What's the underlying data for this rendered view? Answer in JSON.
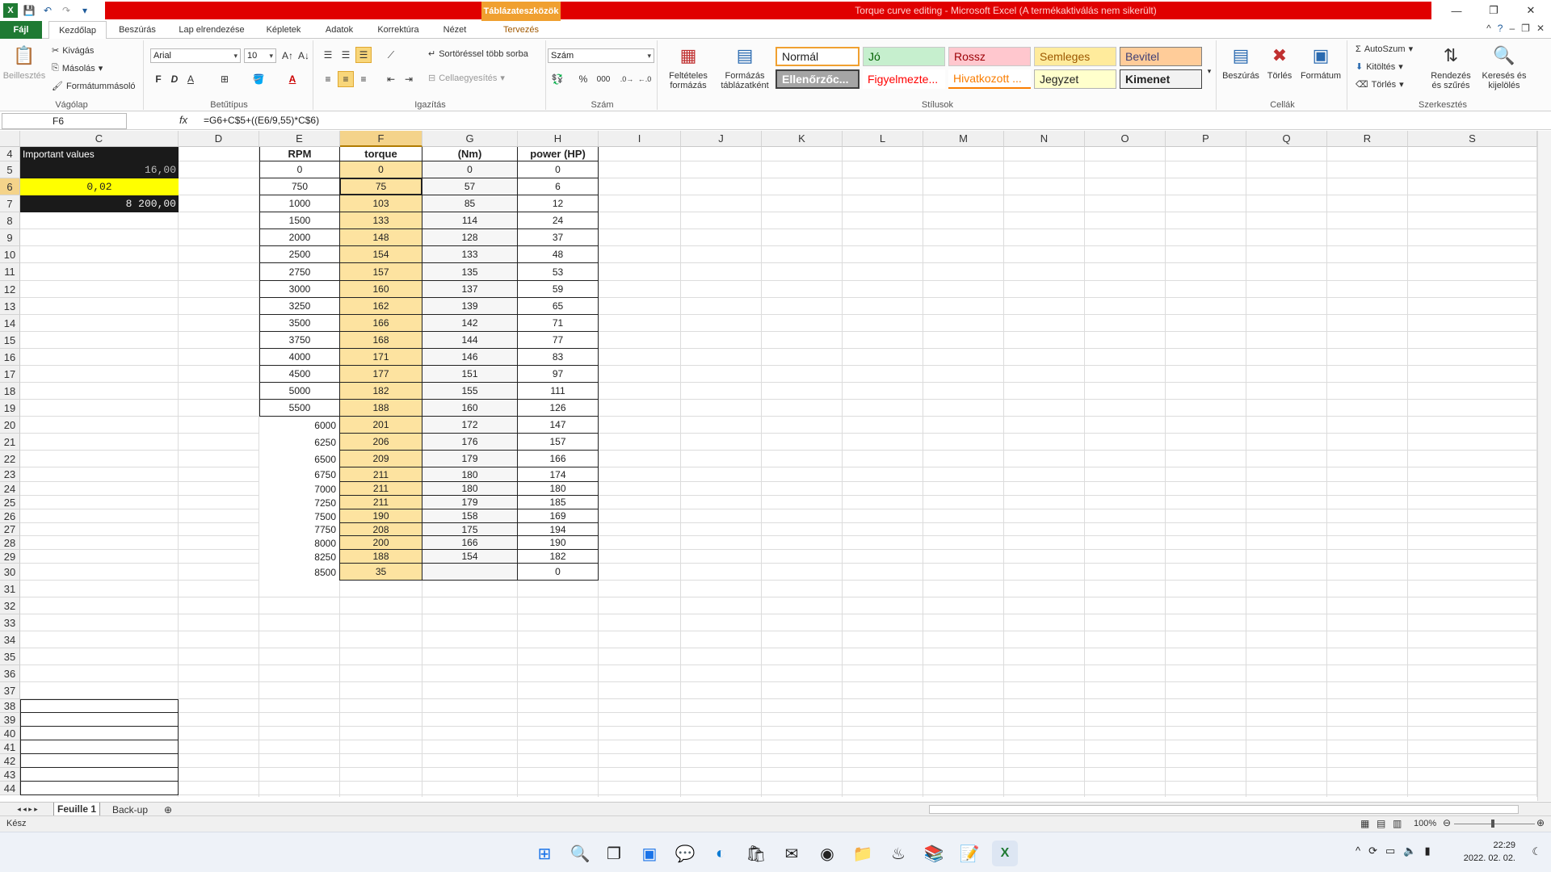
{
  "window": {
    "title": "Torque curve editing  -  Microsoft Excel (A termékaktiválás nem sikerült)",
    "context_tab": "Táblázateszközök"
  },
  "tabs": [
    "Fájl",
    "Kezdőlap",
    "Beszúrás",
    "Lap elrendezése",
    "Képletek",
    "Adatok",
    "Korrektúra",
    "Nézet",
    "Tervezés"
  ],
  "ribbon": {
    "clipboard": {
      "paste": "Beillesztés",
      "cut": "Kivágás",
      "copy": "Másolás",
      "format_painter": "Formátummásoló",
      "label": "Vágólap"
    },
    "font": {
      "name": "Arial",
      "size": "10",
      "bold": "F",
      "italic": "D",
      "underline": "A",
      "label": "Betűtípus"
    },
    "alignment": {
      "wrap": "Sortöréssel több sorba",
      "merge": "Cellaegyesítés",
      "label": "Igazítás"
    },
    "number": {
      "format": "Szám",
      "percent": "%",
      "thousands": "000",
      "label": "Szám"
    },
    "conditional": "Feltételes formázás",
    "format_table": "Formázás táblázatként",
    "styles": {
      "label": "Stílusok",
      "items": [
        "Normál",
        "Jó",
        "Rossz",
        "Semleges",
        "Bevitel",
        "Ellenőrzőc...",
        "Figyelmezte...",
        "Hivatkozott ...",
        "Jegyzet",
        "Kimenet"
      ]
    },
    "cells": {
      "insert": "Beszúrás",
      "delete": "Törlés",
      "format": "Formátum",
      "label": "Cellák"
    },
    "editing": {
      "autosum": "AutoSzum",
      "fill": "Kitöltés",
      "clear": "Törlés",
      "sort": "Rendezés és szűrés",
      "find": "Keresés és kijelölés",
      "label": "Szerkesztés"
    }
  },
  "formula_bar": {
    "name_box": "F6",
    "fx": "fx",
    "formula": "=G6+C$5+((E6/9,55)*C$6)"
  },
  "columns": [
    "C",
    "D",
    "E",
    "F",
    "G",
    "H",
    "I",
    "J",
    "K",
    "L",
    "M",
    "N",
    "O",
    "P",
    "Q",
    "R",
    "S"
  ],
  "rows": [
    "4",
    "5",
    "6",
    "7",
    "8",
    "9",
    "10",
    "11",
    "12",
    "13",
    "14",
    "15",
    "16",
    "17",
    "18",
    "19",
    "20",
    "21",
    "22",
    "23",
    "24",
    "25",
    "26",
    "27",
    "28",
    "29",
    "30",
    "31",
    "32",
    "33",
    "34",
    "35",
    "36",
    "37",
    "38",
    "39",
    "40",
    "41",
    "42",
    "43",
    "44"
  ],
  "values_block": {
    "title": "Important values",
    "v1": "16,00",
    "v2": "0,02",
    "v3": "8 200,00"
  },
  "table": {
    "headers": [
      "RPM",
      "torque",
      "(Nm)",
      "power (HP)"
    ],
    "rows": [
      [
        "0",
        "0",
        "0",
        "0"
      ],
      [
        "750",
        "75",
        "57",
        "6"
      ],
      [
        "1000",
        "103",
        "85",
        "12"
      ],
      [
        "1500",
        "133",
        "114",
        "24"
      ],
      [
        "2000",
        "148",
        "128",
        "37"
      ],
      [
        "2500",
        "154",
        "133",
        "48"
      ],
      [
        "2750",
        "157",
        "135",
        "53"
      ],
      [
        "3000",
        "160",
        "137",
        "59"
      ],
      [
        "3250",
        "162",
        "139",
        "65"
      ],
      [
        "3500",
        "166",
        "142",
        "71"
      ],
      [
        "3750",
        "168",
        "144",
        "77"
      ],
      [
        "4000",
        "171",
        "146",
        "83"
      ],
      [
        "4500",
        "177",
        "151",
        "97"
      ],
      [
        "5000",
        "182",
        "155",
        "111"
      ],
      [
        "5500",
        "188",
        "160",
        "126"
      ],
      [
        "6000",
        "201",
        "172",
        "147"
      ],
      [
        "6250",
        "206",
        "176",
        "157"
      ],
      [
        "6500",
        "209",
        "179",
        "166"
      ],
      [
        "6750",
        "211",
        "180",
        "174"
      ],
      [
        "7000",
        "211",
        "180",
        "180"
      ],
      [
        "7250",
        "211",
        "179",
        "185"
      ],
      [
        "7500",
        "190",
        "158",
        "169"
      ],
      [
        "7750",
        "208",
        "175",
        "194"
      ],
      [
        "8000",
        "200",
        "166",
        "190"
      ],
      [
        "8250",
        "188",
        "154",
        "182"
      ],
      [
        "8500",
        "35",
        "",
        "0"
      ]
    ]
  },
  "sheets": [
    "Feuille 1",
    "Back-up"
  ],
  "status": {
    "ready": "Kész",
    "zoom": "100%"
  },
  "clock": {
    "time": "22:29",
    "date": "2022. 02. 02."
  }
}
